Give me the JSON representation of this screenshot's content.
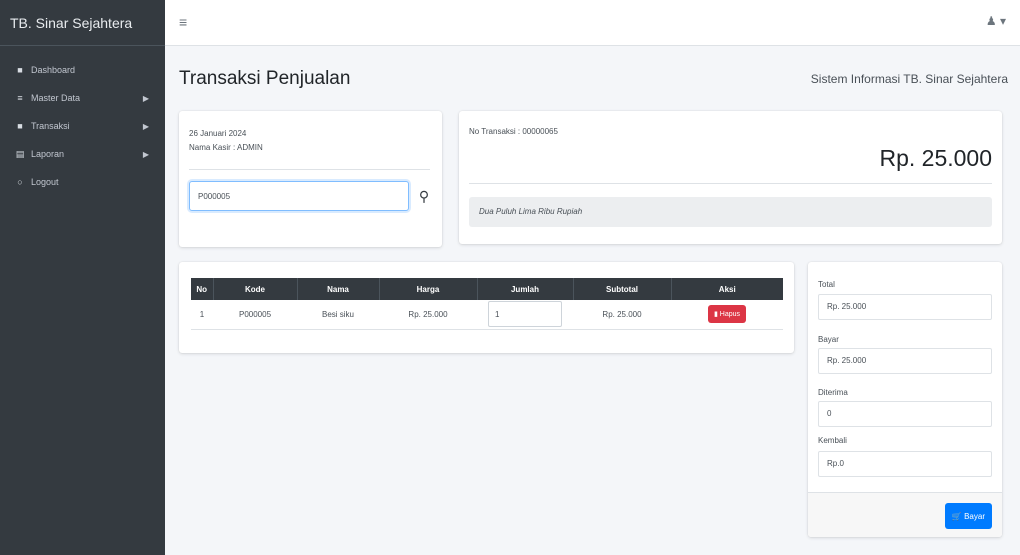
{
  "sidebar": {
    "brand": "TB. Sinar Sejahtera",
    "items": [
      {
        "icon": "dashboard-icon",
        "glyph": "■",
        "label": "Dashboard",
        "caret": ""
      },
      {
        "icon": "database-icon",
        "glyph": "≡",
        "label": "Master Data",
        "caret": "▶"
      },
      {
        "icon": "cart-icon",
        "glyph": "■",
        "label": "Transaksi",
        "caret": "▶"
      },
      {
        "icon": "report-icon",
        "glyph": "▤",
        "label": "Laporan",
        "caret": "▶"
      },
      {
        "icon": "logout-icon",
        "glyph": "○",
        "label": "Logout",
        "caret": ""
      }
    ]
  },
  "topbar": {
    "menu_glyph": "≡",
    "user_glyph": "♟ ▾"
  },
  "header": {
    "title": "Transaksi Penjualan",
    "subtitle": "Sistem Informasi TB. Sinar Sejahtera"
  },
  "info": {
    "date": "26 Januari 2024",
    "kasir": "Nama Kasir : ADMIN",
    "search_value": "P000005",
    "search_glyph": "⚲"
  },
  "transaksi": {
    "no": "No Transaksi : 00000065",
    "amount": "Rp. 25.000",
    "terbilang": "Dua Puluh Lima Ribu Rupiah"
  },
  "table": {
    "columns": [
      "No",
      "Kode",
      "Nama",
      "Harga",
      "Jumlah",
      "Subtotal",
      "Aksi"
    ],
    "rows": [
      {
        "no": "1",
        "kode": "P000005",
        "nama": "Besi siku",
        "harga": "Rp. 25.000",
        "jumlah": "1",
        "subtotal": "Rp. 25.000",
        "aksi": "Hapus"
      }
    ]
  },
  "summary": {
    "total_label": "Total",
    "total_value": "Rp. 25.000",
    "bayar_label": "Bayar",
    "bayar_value": "Rp. 25.000",
    "diterima_label": "Diterima",
    "diterima_value": "0",
    "kembali_label": "Kembali",
    "kembali_value": "Rp.0",
    "button_label": "Bayar"
  },
  "colors": {
    "sidebar": "#343a40",
    "primary": "#007bff",
    "danger": "#dc3545"
  }
}
